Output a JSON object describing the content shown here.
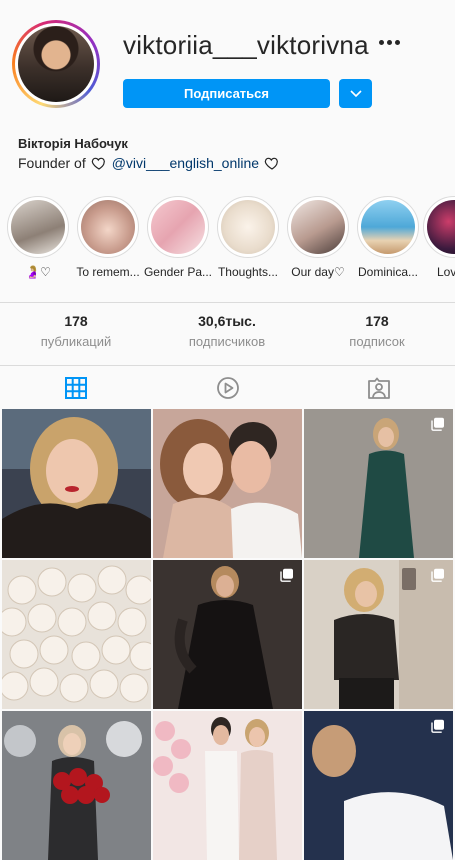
{
  "profile": {
    "username": "viktoriia___viktorivna",
    "follow_label": "Подписаться",
    "full_name": "Вікторія Набочук",
    "bio_prefix": "Founder of",
    "bio_link": "@vivi___english_online"
  },
  "highlights": [
    {
      "label": "🤰🏼♡"
    },
    {
      "label": "To remem..."
    },
    {
      "label": "Gender Pa..."
    },
    {
      "label": "Thoughts..."
    },
    {
      "label": "Our day♡"
    },
    {
      "label": "Dominica..."
    },
    {
      "label": "Lov"
    }
  ],
  "stats": {
    "posts": {
      "value": "178",
      "label": "публикаций"
    },
    "followers": {
      "value": "30,6тыс.",
      "label": "подписчиков"
    },
    "following": {
      "value": "178",
      "label": "подписок"
    }
  },
  "tabs": [
    {
      "icon": "grid-icon",
      "active": true
    },
    {
      "icon": "reels-icon",
      "active": false
    },
    {
      "icon": "tagged-icon",
      "active": false
    }
  ],
  "colors": {
    "accent": "#0095f6",
    "link": "#00376b",
    "secondary_text": "#8e8e8e",
    "border": "#dbdbdb"
  },
  "posts": [
    {
      "multi": false
    },
    {
      "multi": false
    },
    {
      "multi": true
    },
    {
      "multi": false
    },
    {
      "multi": true
    },
    {
      "multi": true
    },
    {
      "multi": false
    },
    {
      "multi": false
    },
    {
      "multi": true
    }
  ]
}
